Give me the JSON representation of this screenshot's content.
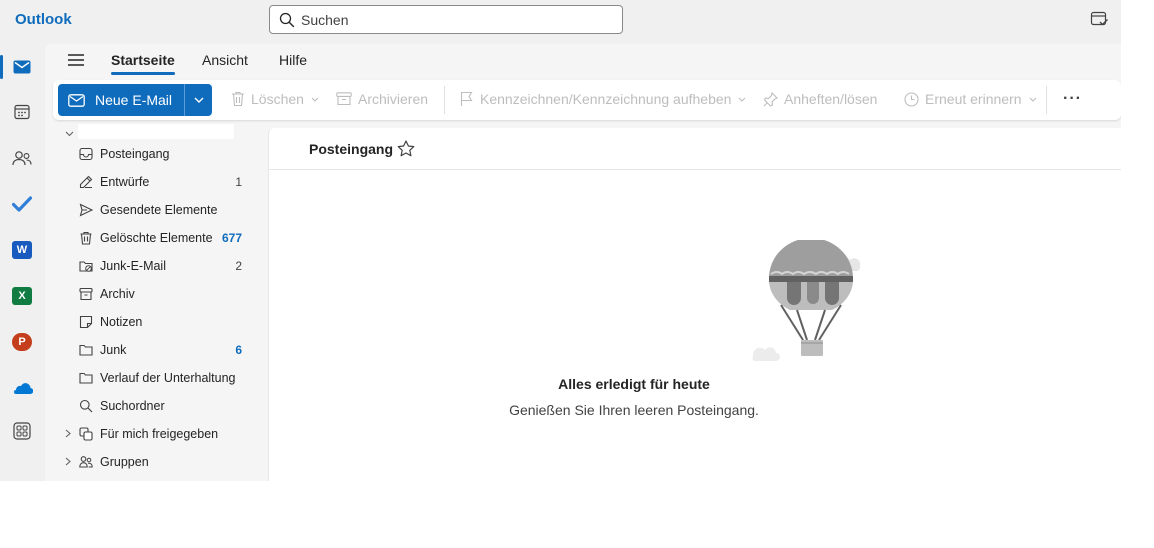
{
  "app": {
    "brand": "Outlook"
  },
  "search": {
    "placeholder": "Suchen"
  },
  "rail": [
    {
      "icon": "mail-icon",
      "active": true
    },
    {
      "icon": "calendar-icon"
    },
    {
      "icon": "people-icon"
    },
    {
      "icon": "todo-icon"
    },
    {
      "icon": "word-icon",
      "letter": "W"
    },
    {
      "icon": "excel-icon",
      "letter": "X"
    },
    {
      "icon": "powerpoint-icon",
      "letter": "P"
    },
    {
      "icon": "onedrive-icon"
    },
    {
      "icon": "apps-icon"
    }
  ],
  "tabs": [
    {
      "label": "Startseite",
      "active": true
    },
    {
      "label": "Ansicht"
    },
    {
      "label": "Hilfe"
    }
  ],
  "ribbon": {
    "new_mail": "Neue E-Mail",
    "delete": "Löschen",
    "archive": "Archivieren",
    "flag": "Kennzeichnen/Kennzeichnung aufheben",
    "pin": "Anheften/lösen",
    "snooze": "Erneut erinnern",
    "more": "···"
  },
  "folders": [
    {
      "label": "Posteingang",
      "count": "",
      "icon": "inbox-icon"
    },
    {
      "label": "Entwürfe",
      "count": "1",
      "icon": "drafts-icon"
    },
    {
      "label": "Gesendete Elemente",
      "count": "",
      "icon": "sent-icon"
    },
    {
      "label": "Gelöschte Elemente",
      "count": "677",
      "icon": "trash-icon",
      "count_blue": true
    },
    {
      "label": "Junk-E-Mail",
      "count": "2",
      "icon": "junk-icon"
    },
    {
      "label": "Archiv",
      "count": "",
      "icon": "archive-icon"
    },
    {
      "label": "Notizen",
      "count": "",
      "icon": "notes-icon"
    },
    {
      "label": "Junk",
      "count": "6",
      "icon": "folder-icon",
      "count_blue": true
    },
    {
      "label": "Verlauf der Unterhaltung",
      "count": "",
      "icon": "folder-icon"
    },
    {
      "label": "Suchordner",
      "count": "",
      "icon": "search-folder-icon"
    },
    {
      "label": "Für mich freigegeben",
      "count": "",
      "icon": "shared-icon",
      "expandable": true
    },
    {
      "label": "Gruppen",
      "count": "",
      "icon": "groups-icon",
      "expandable": true
    }
  ],
  "messages": {
    "header": "Posteingang",
    "empty_title": "Alles erledigt für heute",
    "empty_subtitle": "Genießen Sie Ihren leeren Posteingang."
  },
  "colors": {
    "accent": "#0f6cbd",
    "word": "#185abd",
    "excel": "#107c41",
    "powerpoint": "#c43e1c",
    "onedrive": "#0078d4"
  }
}
